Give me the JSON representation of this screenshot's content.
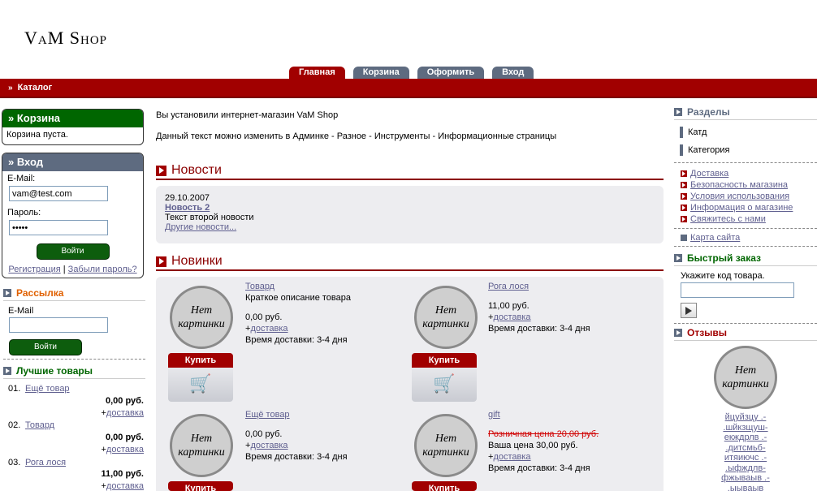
{
  "header": {
    "logo": "VaM Shop",
    "tabs": [
      {
        "label": "Главная"
      },
      {
        "label": "Корзина"
      },
      {
        "label": "Оформить"
      },
      {
        "label": "Вход"
      }
    ],
    "catalog": "Каталог"
  },
  "cart_box": {
    "title": "» Корзина",
    "text": "Корзина пуста."
  },
  "login_box": {
    "title": "» Вход",
    "email_label": "E-Mail:",
    "email_value": "vam@test.com",
    "password_label": "Пароль:",
    "password_value": "•••••",
    "submit": "Войти",
    "register": "Регистрация",
    "sep": "|",
    "forgot": "Забыли пароль?"
  },
  "newsletter": {
    "title": "Рассылка",
    "email_label": "E-Mail",
    "submit": "Войти"
  },
  "bestsellers": {
    "title": "Лучшие товары",
    "items": [
      {
        "num": "01.",
        "name": "Ещё товар",
        "price": "0,00 руб.",
        "plus": "+",
        "delivery": "доставка"
      },
      {
        "num": "02.",
        "name": "Товард",
        "price": "0,00 руб.",
        "plus": "+",
        "delivery": "доставка"
      },
      {
        "num": "03.",
        "name": "Рога лося",
        "price": "11,00 руб.",
        "plus": "+",
        "delivery": "доставка"
      }
    ]
  },
  "main": {
    "intro1": "Вы установили интернет-магазин VaM Shop",
    "intro2": "Данный текст можно изменить в Админке - Разное - Инструменты - Информационные страницы",
    "news_title": "Новости",
    "news": {
      "date": "29.10.2007",
      "title": "Новость 2",
      "text": "Текст второй новости",
      "more": "Другие новости..."
    },
    "new_title": "Новинки",
    "no_picture": "Нет картинки",
    "buy": "Купить",
    "products": [
      {
        "name": "Товард",
        "desc": "Краткое описание товара",
        "price": "0,00 руб.",
        "plus": "+",
        "delivery": "доставка",
        "time": "Время доставки:  3-4 дня"
      },
      {
        "name": "Рога лося",
        "price": "11,00 руб.",
        "plus": "+",
        "delivery": "доставка",
        "time": "Время доставки:  3-4 дня"
      },
      {
        "name": "Ещё товар",
        "price": "0,00 руб.",
        "plus": "+",
        "delivery": "доставка",
        "time": "Время доставки:  3-4 дня"
      },
      {
        "name": "gift",
        "old_price": "Розничная цена 20,00 руб.",
        "price": "Ваша цена 30,00 руб.",
        "plus": "+",
        "delivery": "доставка",
        "time": "Время доставки:  3-4 дня"
      }
    ]
  },
  "right": {
    "sections_title": "Разделы",
    "categories": [
      "Катд",
      "Категория"
    ],
    "info_links": [
      "Доставка",
      "Безопасность магазина",
      "Условия использования",
      "Информация о магазине",
      "Свяжитесь с нами"
    ],
    "sitemap": "Карта сайта",
    "quick_title": "Быстрый заказ",
    "quick_label": "Укажите код товара.",
    "reviews_title": "Отзывы",
    "review_lines": [
      "йцуйзцу .-",
      ".шйкзщуш-",
      "екждрлв .-",
      ".дитсмьб-",
      "итяиючс .-",
      ".ыфждлв-",
      "фжываыв .-",
      ".ыываыв"
    ]
  },
  "colors": {
    "brand_red": "#a10000",
    "box_green": "#006600",
    "slate": "#5e6b80"
  }
}
